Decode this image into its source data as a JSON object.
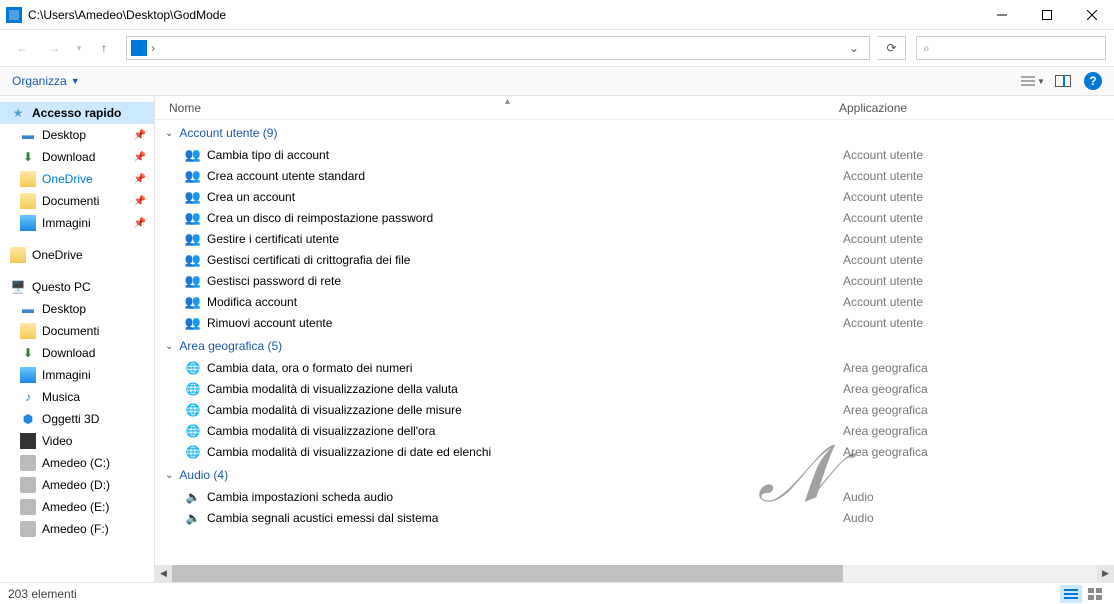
{
  "title": "C:\\Users\\Amedeo\\Desktop\\GodMode",
  "cmdbar": {
    "organize": "Organizza"
  },
  "columns": {
    "name": "Nome",
    "app": "Applicazione"
  },
  "sidebar": {
    "quick": "Accesso rapido",
    "quick_items": [
      {
        "label": "Desktop",
        "icon": "desktop",
        "pinned": true
      },
      {
        "label": "Download",
        "icon": "down",
        "pinned": true
      },
      {
        "label": "OneDrive",
        "icon": "onedrive",
        "pinned": true,
        "accent": true
      },
      {
        "label": "Documenti",
        "icon": "folder",
        "pinned": true
      },
      {
        "label": "Immagini",
        "icon": "img",
        "pinned": true
      }
    ],
    "onedrive": "OneDrive",
    "thispc": "Questo PC",
    "pc_items": [
      {
        "label": "Desktop",
        "icon": "desktop"
      },
      {
        "label": "Documenti",
        "icon": "folder"
      },
      {
        "label": "Download",
        "icon": "down"
      },
      {
        "label": "Immagini",
        "icon": "img"
      },
      {
        "label": "Musica",
        "icon": "music"
      },
      {
        "label": "Oggetti 3D",
        "icon": "3d"
      },
      {
        "label": "Video",
        "icon": "video"
      },
      {
        "label": "Amedeo (C:)",
        "icon": "drive"
      },
      {
        "label": "Amedeo (D:)",
        "icon": "drive"
      },
      {
        "label": "Amedeo (E:)",
        "icon": "drive"
      },
      {
        "label": "Amedeo (F:)",
        "icon": "drive"
      }
    ]
  },
  "groups": [
    {
      "title": "Account utente",
      "count": 9,
      "icon": "users",
      "app": "Account utente",
      "items": [
        "Cambia tipo di account",
        "Crea account utente standard",
        "Crea un account",
        "Crea un disco di reimpostazione password",
        "Gestire i certificati utente",
        "Gestisci certificati di crittografia dei file",
        "Gestisci password di rete",
        "Modifica account",
        "Rimuovi account utente"
      ]
    },
    {
      "title": "Area geografica",
      "count": 5,
      "icon": "globe",
      "app": "Area geografica",
      "items": [
        "Cambia data, ora o formato dei numeri",
        "Cambia modalità di visualizzazione della valuta",
        "Cambia modalità di visualizzazione delle misure",
        "Cambia modalità di visualizzazione dell'ora",
        "Cambia modalità di visualizzazione di date ed elenchi"
      ]
    },
    {
      "title": "Audio",
      "count": 4,
      "icon": "speaker",
      "app": "Audio",
      "items": [
        "Cambia impostazioni scheda audio",
        "Cambia segnali acustici emessi dal sistema"
      ]
    }
  ],
  "status": {
    "count": "203 elementi"
  }
}
